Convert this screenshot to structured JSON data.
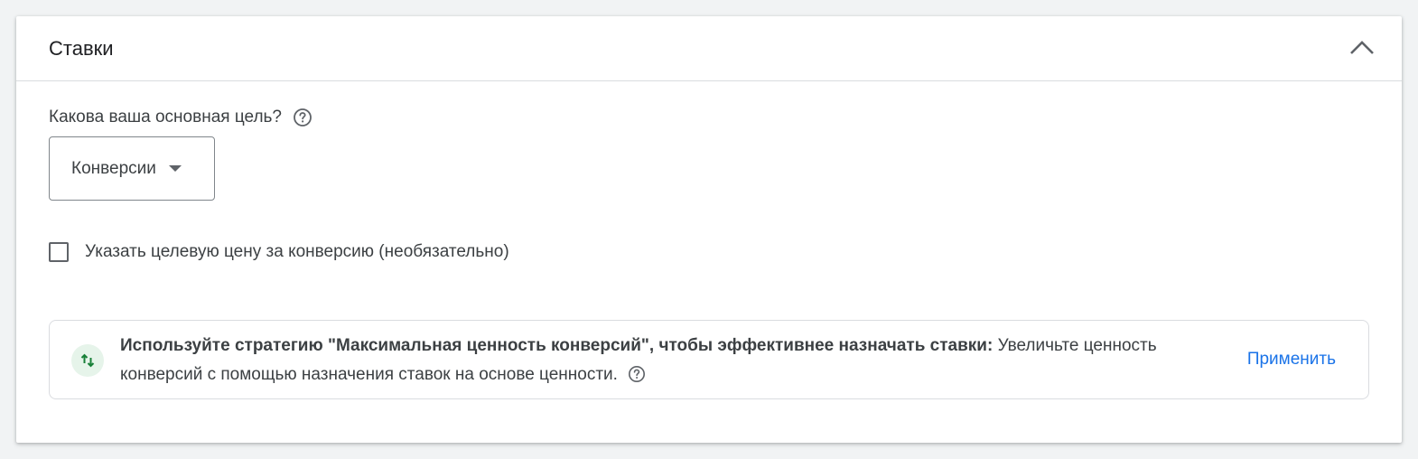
{
  "section": {
    "title": "Ставки",
    "collapse_icon": "chevron-up-icon"
  },
  "goal": {
    "question": "Какова ваша основная цель?",
    "help_icon": "help-circle-icon",
    "selected_value": "Конверсии"
  },
  "target_cpa": {
    "label": "Указать целевую цену за конверсию (необязательно)",
    "checked": false
  },
  "recommendation": {
    "icon": "arrows-up-down-icon",
    "bold_text": "Используйте стратегию \"Максимальная ценность конверсий\", чтобы эффективнее назначать ставки:",
    "text": "Увеличьте ценность конверсий с помощью назначения ставок на основе ценности.",
    "help_icon": "help-circle-icon",
    "apply_label": "Применить"
  },
  "colors": {
    "accent": "#1a73e8",
    "recommendation_icon": "#188038",
    "recommendation_icon_bg": "#e6f4ea"
  }
}
